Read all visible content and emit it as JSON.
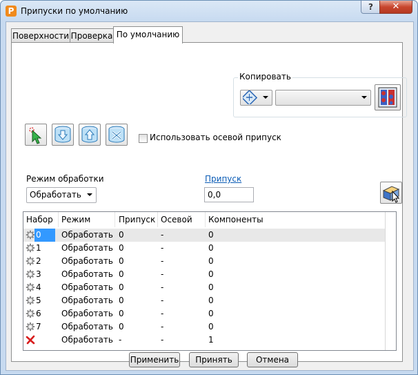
{
  "window": {
    "title": "Припуски по умолчанию",
    "app_icon_letter": "P",
    "help_glyph": "?",
    "close_glyph": "✕"
  },
  "tabs": [
    {
      "label": "Поверхности",
      "active": false
    },
    {
      "label": "Проверка",
      "active": false
    },
    {
      "label": "По умолчанию",
      "active": true
    }
  ],
  "copy_group": {
    "label": "Копировать",
    "dropdown_value": ""
  },
  "toolbar_icons": [
    "select-arrow-icon",
    "cylinder-down-icon",
    "cylinder-up-icon",
    "cylinder-tools-icon"
  ],
  "use_axial_allowance": {
    "label": "Использовать осевой припуск",
    "checked": false
  },
  "mode": {
    "label": "Режим обработки",
    "value": "Обработать"
  },
  "allowance": {
    "label": "Припуск",
    "value": "0,0"
  },
  "table": {
    "columns": [
      "Набор",
      "Режим",
      "Припуск",
      "Осевой",
      "Компоненты"
    ],
    "rows": [
      {
        "set": "0",
        "mode": "Обработать",
        "allowance": "0",
        "axial": "-",
        "components": "0",
        "icon": "gear-icon"
      },
      {
        "set": "1",
        "mode": "Обработать",
        "allowance": "0",
        "axial": "-",
        "components": "0",
        "icon": "gear-icon"
      },
      {
        "set": "2",
        "mode": "Обработать",
        "allowance": "0",
        "axial": "-",
        "components": "0",
        "icon": "gear-icon"
      },
      {
        "set": "3",
        "mode": "Обработать",
        "allowance": "0",
        "axial": "-",
        "components": "0",
        "icon": "gear-icon"
      },
      {
        "set": "4",
        "mode": "Обработать",
        "allowance": "0",
        "axial": "-",
        "components": "0",
        "icon": "gear-icon"
      },
      {
        "set": "5",
        "mode": "Обработать",
        "allowance": "0",
        "axial": "-",
        "components": "0",
        "icon": "gear-icon"
      },
      {
        "set": "6",
        "mode": "Обработать",
        "allowance": "0",
        "axial": "-",
        "components": "0",
        "icon": "gear-icon"
      },
      {
        "set": "7",
        "mode": "Обработать",
        "allowance": "0",
        "axial": "-",
        "components": "0",
        "icon": "gear-icon"
      },
      {
        "set": "",
        "mode": "Обработать",
        "allowance": "-",
        "axial": "-",
        "components": "1",
        "icon": "red-x-icon"
      }
    ]
  },
  "footer": {
    "apply_label": "Применить",
    "accept_label": "Принять",
    "cancel_label": "Отмена"
  }
}
